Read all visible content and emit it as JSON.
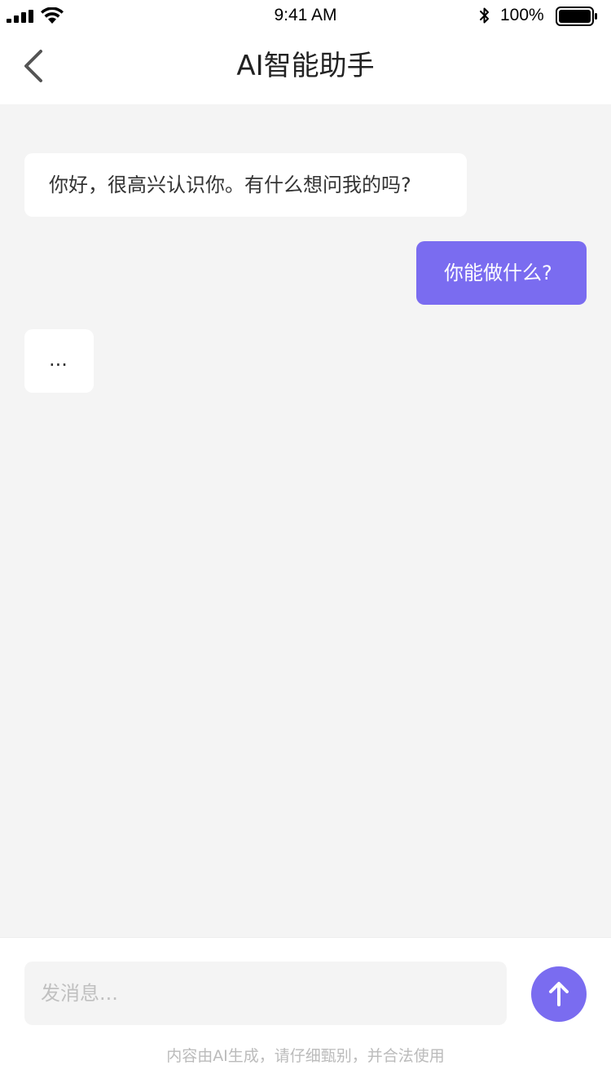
{
  "status_bar": {
    "time": "9:41 AM",
    "battery_percent": "100%",
    "icons": [
      "signal-icon",
      "wifi-icon",
      "bluetooth-icon",
      "battery-icon"
    ]
  },
  "header": {
    "title": "AI智能助手",
    "back_icon": "chevron-left-icon"
  },
  "messages": [
    {
      "role": "assistant",
      "text": "你好，很高兴认识你。有什么想问我的吗?"
    },
    {
      "role": "user",
      "text": "你能做什么?"
    },
    {
      "role": "assistant",
      "text": "..."
    }
  ],
  "composer": {
    "placeholder": "发消息...",
    "value": "",
    "send_icon": "arrow-up-icon"
  },
  "footer": {
    "disclaimer": "内容由AI生成，请仔细甄别，并合法使用"
  },
  "colors": {
    "accent": "#7a6cf0",
    "chat_background": "#f4f4f4",
    "ai_bubble": "#ffffff",
    "user_bubble": "#7a6cf0"
  }
}
